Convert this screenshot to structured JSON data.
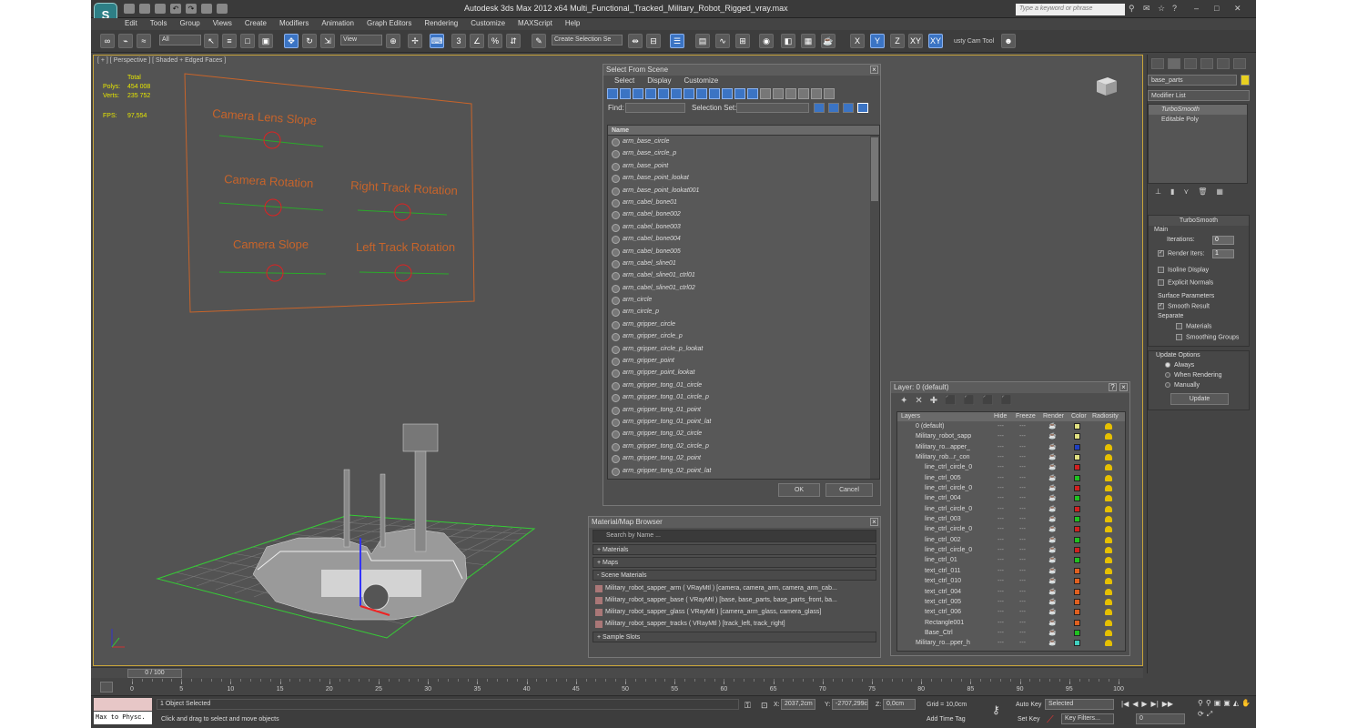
{
  "app": {
    "logo": "S",
    "title": "Autodesk 3ds Max  2012 x64      Multi_Functional_Tracked_Military_Robot_Rigged_vray.max",
    "search_placeholder": "Type a keyword or phrase"
  },
  "menus": [
    "Edit",
    "Tools",
    "Group",
    "Views",
    "Create",
    "Modifiers",
    "Animation",
    "Graph Editors",
    "Rendering",
    "Customize",
    "MAXScript",
    "Help"
  ],
  "toolbar": {
    "filter": "All",
    "view": "View",
    "selection_set": "Create Selection Se",
    "cam_tool": "usty Cam Tool"
  },
  "viewport": {
    "label": "[ + ] [ Perspective ] [ Shaded + Edged Faces ]",
    "stats_total": "Total",
    "polys_label": "Polys:",
    "polys": "454 008",
    "verts_label": "Verts:",
    "verts": "235 752",
    "fps_label": "FPS:",
    "fps": "97,554",
    "panel_labels": [
      "Camera Lens Slope",
      "Camera Rotation",
      "Right Track Rotation",
      "Camera Slope",
      "Left Track Rotation"
    ]
  },
  "select_scene": {
    "title": "Select From Scene",
    "menu": [
      "Select",
      "Display",
      "Customize"
    ],
    "find_label": "Find:",
    "sel_set_label": "Selection Set:",
    "col_name": "Name",
    "items": [
      "arm_base_circle",
      "arm_base_circle_p",
      "arm_base_point",
      "arm_base_point_lookat",
      "arm_base_point_lookat001",
      "arm_cabel_bone01",
      "arm_cabel_bone002",
      "arm_cabel_bone003",
      "arm_cabel_bone004",
      "arm_cabel_bone005",
      "arm_cabel_sline01",
      "arm_cabel_sline01_ctrl01",
      "arm_cabel_sline01_ctrl02",
      "arm_circle",
      "arm_circle_p",
      "arm_gripper_circle",
      "arm_gripper_circle_p",
      "arm_gripper_circle_p_lookat",
      "arm_gripper_point",
      "arm_gripper_point_lookat",
      "arm_gripper_tong_01_circle",
      "arm_gripper_tong_01_circle_p",
      "arm_gripper_tong_01_point",
      "arm_gripper_tong_01_point_lat",
      "arm_gripper_tong_02_circle",
      "arm_gripper_tong_02_circle_p",
      "arm_gripper_tong_02_point",
      "arm_gripper_tong_02_point_lat"
    ],
    "ok": "OK",
    "cancel": "Cancel"
  },
  "mat_browser": {
    "title": "Material/Map Browser",
    "search": "Search by Name ...",
    "sec_materials": "+ Materials",
    "sec_maps": "+ Maps",
    "sec_scene": "- Scene Materials",
    "rows": [
      "Military_robot_sapper_arm  ( VRayMtl ) [camera, camera_arm, camera_arm_cab...",
      "Military_robot_sapper_base ( VRayMtl ) [base, base_parts, base_parts_front, ba...",
      "Military_robot_sapper_glass  ( VRayMtl ) [camera_arm_glass, camera_glass]",
      "Military_robot_sapper_tracks  ( VRayMtl ) [track_left, track_right]"
    ],
    "sec_sample": "+ Sample Slots"
  },
  "layer": {
    "title": "Layer: 0 (default)",
    "cols": [
      "Layers",
      "Hide",
      "Freeze",
      "Render",
      "Color",
      "Radiosity"
    ],
    "rows": [
      {
        "name": "0 (default)",
        "indent": 0,
        "color": "#e0e080"
      },
      {
        "name": "Military_robot_sapp",
        "indent": 0,
        "color": "#e0e080"
      },
      {
        "name": "Military_ro...apper_",
        "indent": 0,
        "color": "#2040c0"
      },
      {
        "name": "Military_rob...r_con",
        "indent": 0,
        "color": "#e0e080"
      },
      {
        "name": "line_ctrl_circle_0",
        "indent": 1,
        "color": "#d02020"
      },
      {
        "name": "line_ctrl_005",
        "indent": 1,
        "color": "#20c020"
      },
      {
        "name": "line_ctrl_circle_0",
        "indent": 1,
        "color": "#d02020"
      },
      {
        "name": "line_ctrl_004",
        "indent": 1,
        "color": "#20c020"
      },
      {
        "name": "line_ctrl_circle_0",
        "indent": 1,
        "color": "#d02020"
      },
      {
        "name": "line_ctrl_003",
        "indent": 1,
        "color": "#20c020"
      },
      {
        "name": "line_ctrl_circle_0",
        "indent": 1,
        "color": "#d02020"
      },
      {
        "name": "line_ctrl_002",
        "indent": 1,
        "color": "#20c020"
      },
      {
        "name": "line_ctrl_circle_0",
        "indent": 1,
        "color": "#d02020"
      },
      {
        "name": "line_ctrl_01",
        "indent": 1,
        "color": "#20c020"
      },
      {
        "name": "text_ctrl_011",
        "indent": 1,
        "color": "#e06020"
      },
      {
        "name": "text_ctrl_010",
        "indent": 1,
        "color": "#e06020"
      },
      {
        "name": "text_ctrl_004",
        "indent": 1,
        "color": "#e06020"
      },
      {
        "name": "text_ctrl_005",
        "indent": 1,
        "color": "#e06020"
      },
      {
        "name": "text_ctrl_006",
        "indent": 1,
        "color": "#e06020"
      },
      {
        "name": "Rectangle001",
        "indent": 1,
        "color": "#e06020"
      },
      {
        "name": "Base_Ctrl",
        "indent": 1,
        "color": "#20c020"
      },
      {
        "name": "Military_ro...pper_h",
        "indent": 0,
        "color": "#40d0c0"
      }
    ]
  },
  "command": {
    "object_name": "base_parts",
    "modifier_list": "Modifier List",
    "stack": [
      "TurboSmooth",
      "Editable Poly"
    ],
    "ts_title": "TurboSmooth",
    "main": "Main",
    "iterations_label": "Iterations:",
    "iterations": "0",
    "render_iters_label": "Render Iters:",
    "render_iters": "1",
    "isoline": "Isoline Display",
    "explicit": "Explicit Normals",
    "surface": "Surface Parameters",
    "smooth_result": "Smooth Result",
    "separate": "Separate",
    "materials": "Materials",
    "smoothing_groups": "Smoothing Groups",
    "update_options": "Update Options",
    "always": "Always",
    "when_rendering": "When Rendering",
    "manually": "Manually",
    "update": "Update"
  },
  "timeline": {
    "frame": "0 / 100",
    "ticks": [
      "0",
      "5",
      "10",
      "15",
      "20",
      "25",
      "30",
      "35",
      "40",
      "45",
      "50",
      "55",
      "60",
      "65",
      "70",
      "75",
      "80",
      "85",
      "90",
      "95",
      "100"
    ]
  },
  "status": {
    "maxscript": "Max to Physc.",
    "selected": "1 Object Selected",
    "prompt": "Click and drag to select and move objects",
    "x_label": "X:",
    "x": "2037,2cm",
    "y_label": "Y:",
    "y": "-2707,299c",
    "z_label": "Z:",
    "z": "0,0cm",
    "grid": "Grid = 10,0cm",
    "add_time_tag": "Add Time Tag",
    "auto_key": "Auto Key",
    "set_key": "Set Key",
    "selected_drop": "Selected",
    "key_filters": "Key Filters...",
    "frame_field": "0"
  }
}
